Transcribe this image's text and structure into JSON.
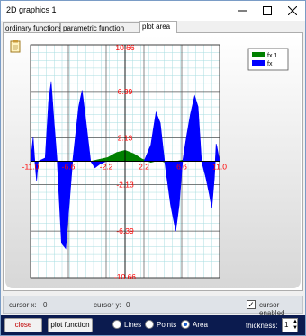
{
  "window": {
    "title": "2D graphics 1"
  },
  "tabs": [
    "ordinary functions",
    "parametric function",
    "plot area"
  ],
  "active_tab": "plot area",
  "legend": [
    "fx 1",
    "fx"
  ],
  "status": {
    "cursor_x_label": "cursor x:",
    "cursor_x": "0",
    "cursor_y_label": "cursor y:",
    "cursor_y": "0",
    "cursor_enabled": "cursor enabled"
  },
  "toolbar": {
    "close": "close",
    "plot": "plot function",
    "modes": [
      "Lines",
      "Points",
      "Area"
    ],
    "selected_mode": "Area",
    "thickness_label": "thickness:",
    "thickness": "1"
  },
  "colors": {
    "series1": "#008000",
    "series2": "#0000ff",
    "axis_labels": "#ff0000",
    "grid": "#a8dde0"
  },
  "chart_data": {
    "type": "area",
    "x_ticks": [
      "-11.0",
      "-6.6",
      "-2.2",
      "2.2",
      "6.6",
      "11.0"
    ],
    "y_ticks": [
      "10.66",
      "6.39",
      "2.13",
      "-2.13",
      "-6.39",
      "-10.66"
    ],
    "xlim": [
      -11,
      11
    ],
    "ylim": [
      -10.66,
      10.66
    ],
    "series": [
      {
        "name": "fx 1",
        "color": "#008000",
        "points": [
          [
            -4,
            0
          ],
          [
            -2,
            0.35
          ],
          [
            -1,
            0.8
          ],
          [
            0,
            1.0
          ],
          [
            1,
            0.7
          ],
          [
            2,
            0.2
          ],
          [
            3,
            -0.1
          ],
          [
            4,
            0.1
          ],
          [
            5,
            -0.2
          ],
          [
            6,
            0
          ],
          [
            7,
            0.15
          ],
          [
            8,
            0
          ]
        ]
      },
      {
        "name": "fx",
        "color": "#0000ff",
        "points": [
          [
            -11,
            0
          ],
          [
            -10.7,
            2.2
          ],
          [
            -10.5,
            0
          ],
          [
            -10.3,
            -1.8
          ],
          [
            -10.1,
            0
          ],
          [
            -9.3,
            0.3
          ],
          [
            -8.9,
            5.5
          ],
          [
            -8.6,
            7.3
          ],
          [
            -8.3,
            4
          ],
          [
            -7.9,
            0
          ],
          [
            -7.4,
            -7.5
          ],
          [
            -6.9,
            -8
          ],
          [
            -6.5,
            -4
          ],
          [
            -6.1,
            0
          ],
          [
            -5.4,
            5
          ],
          [
            -5,
            6.5
          ],
          [
            -4.6,
            4
          ],
          [
            -4,
            0
          ],
          [
            -3.5,
            -0.6
          ],
          [
            -3,
            -0.3
          ],
          [
            -2.2,
            0
          ],
          [
            2.2,
            0
          ],
          [
            3,
            1.5
          ],
          [
            3.6,
            4.5
          ],
          [
            4.1,
            3.5
          ],
          [
            4.6,
            0
          ],
          [
            5.3,
            -4
          ],
          [
            5.9,
            -6.4
          ],
          [
            6.3,
            -4
          ],
          [
            6.7,
            0
          ],
          [
            7.2,
            2.5
          ],
          [
            7.6,
            4.3
          ],
          [
            8.1,
            6
          ],
          [
            8.5,
            5
          ],
          [
            8.9,
            0
          ],
          [
            9.4,
            -1.5
          ],
          [
            9.8,
            -3
          ],
          [
            10.1,
            -4.3
          ],
          [
            10.4,
            -1.5
          ],
          [
            10.6,
            1.6
          ],
          [
            10.7,
            1.3
          ],
          [
            11,
            0
          ]
        ]
      }
    ]
  }
}
